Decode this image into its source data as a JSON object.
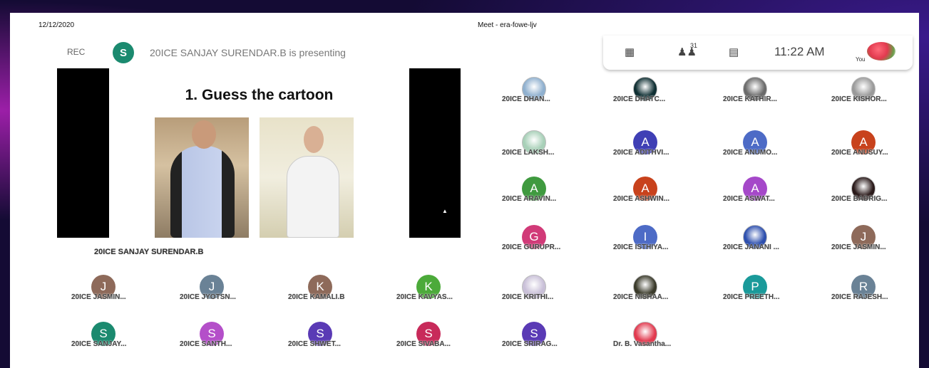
{
  "header": {
    "date": "12/12/2020",
    "meeting_title": "Meet - era-fowe-ljv"
  },
  "presenter_bar": {
    "rec_label": "REC",
    "avatar_letter": "S",
    "avatar_color": "#1b8a6f",
    "presenting_text": "20ICE SANJAY SURENDAR.B is presenting"
  },
  "controls": {
    "layout_icon": "grid-icon",
    "people_icon": "people-icon",
    "people_count": "31",
    "chat_icon": "chat-icon",
    "time": "11:22 AM",
    "you_label": "You"
  },
  "slide": {
    "title": "1. Guess the cartoon",
    "presenter_name": "20ICE SANJAY SURENDAR.B"
  },
  "participants": [
    {
      "label": "20ICE DHAN...",
      "type": "photo",
      "color": "#8fb0cf"
    },
    {
      "label": "20ICE DHATC...",
      "type": "photo",
      "color": "#0f2f33"
    },
    {
      "label": "20ICE KATHIR...",
      "type": "photo",
      "color": "#6a6a6a"
    },
    {
      "label": "20ICE KISHOR...",
      "type": "photo",
      "color": "#9a9a9a"
    },
    {
      "label": "20ICE LAKSH...",
      "type": "photo",
      "color": "#a8d0b8"
    },
    {
      "label": "20ICE ADITHVI...",
      "type": "letter",
      "letter": "A",
      "color": "#3f3fb5"
    },
    {
      "label": "20ICE ANUMO...",
      "type": "letter",
      "letter": "A",
      "color": "#4d6bc6"
    },
    {
      "label": "20ICE ANUSUY...",
      "type": "letter",
      "letter": "A",
      "color": "#c8421c"
    },
    {
      "label": "20ICE ARAVIN...",
      "type": "letter",
      "letter": "A",
      "color": "#3f9a3f"
    },
    {
      "label": "20ICE ASHWIN...",
      "type": "letter",
      "letter": "A",
      "color": "#c8421c"
    },
    {
      "label": "20ICE ASWAT...",
      "type": "letter",
      "letter": "A",
      "color": "#a548c9"
    },
    {
      "label": "20ICE BADRIG...",
      "type": "photo",
      "color": "#2a1a1a"
    },
    {
      "label": "20ICE GURUPR...",
      "type": "letter",
      "letter": "G",
      "color": "#d13a78"
    },
    {
      "label": "20ICE ISTHIYA...",
      "type": "letter",
      "letter": "I",
      "color": "#4d6bc6"
    },
    {
      "label": "20ICE JANANI ...",
      "type": "photo",
      "color": "#2d4fae"
    },
    {
      "label": "20ICE JASMIN...",
      "type": "letter",
      "letter": "J",
      "color": "#8e6a5a"
    },
    {
      "label": "20ICE JASMIN...",
      "type": "letter",
      "letter": "J",
      "color": "#8e6a5a"
    },
    {
      "label": "20ICE JYOTSN...",
      "type": "letter",
      "letter": "J",
      "color": "#6a8296"
    },
    {
      "label": "20ICE KAMALI.B",
      "type": "letter",
      "letter": "K",
      "color": "#8e6a5a"
    },
    {
      "label": "20ICE KAVYAS...",
      "type": "letter",
      "letter": "K",
      "color": "#4caa3a"
    },
    {
      "label": "20ICE KRITHI...",
      "type": "photo",
      "color": "#c9c0d8"
    },
    {
      "label": "20ICE NISHAA...",
      "type": "photo",
      "color": "#3a3a2a"
    },
    {
      "label": "20ICE PREETH...",
      "type": "letter",
      "letter": "P",
      "color": "#1a9a9a"
    },
    {
      "label": "20ICE RAJESH...",
      "type": "letter",
      "letter": "R",
      "color": "#6a8296"
    },
    {
      "label": "20ICE SANJAY...",
      "type": "letter",
      "letter": "S",
      "color": "#1b8a6f"
    },
    {
      "label": "20ICE SANTH...",
      "type": "letter",
      "letter": "S",
      "color": "#b44fc9"
    },
    {
      "label": "20ICE SHWET...",
      "type": "letter",
      "letter": "S",
      "color": "#5a3ab5"
    },
    {
      "label": "20ICE SIVABA...",
      "type": "letter",
      "letter": "S",
      "color": "#c82a5a"
    },
    {
      "label": "20ICE SRIRAG...",
      "type": "letter",
      "letter": "S",
      "color": "#5a3ab5"
    },
    {
      "label": "Dr. B. Vasantha...",
      "type": "photo",
      "color": "#e23a4f"
    }
  ]
}
